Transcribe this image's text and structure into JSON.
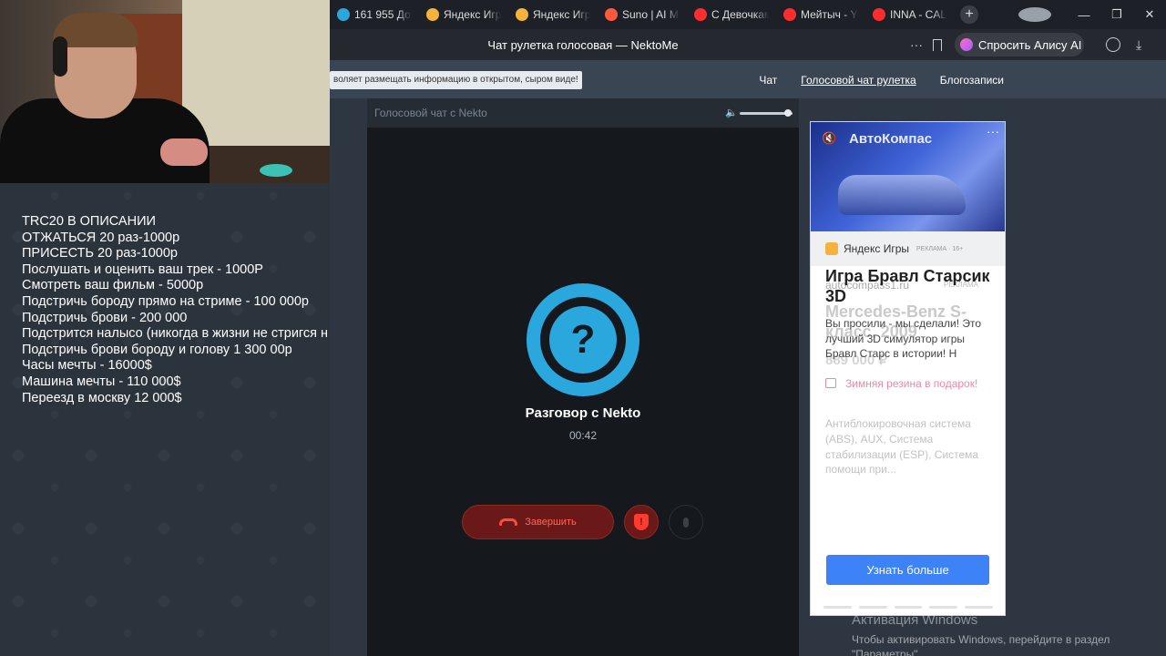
{
  "browser": {
    "tabs": [
      {
        "title": "161 955 Дол",
        "color": "#2aa7dd"
      },
      {
        "title": "Яндекс Игры",
        "color": "#f3b33d"
      },
      {
        "title": "Яндекс Игры",
        "color": "#f3b33d"
      },
      {
        "title": "Suno | AI Mu",
        "color": "#ff5a3d"
      },
      {
        "title": "С Девочкам",
        "color": "#ff2d2d"
      },
      {
        "title": "Мейтыч - Yo",
        "color": "#ff2d2d"
      },
      {
        "title": "INNA - CALI",
        "color": "#ff2d2d"
      }
    ],
    "new_tab": "+",
    "window_controls": {
      "minimize": "—",
      "maximize": "❐",
      "close": "✕"
    },
    "page_title": "Чат рулетка голосовая — NektoMe",
    "more": "···",
    "alice_button": "Спросить Алису AI",
    "download": "⤓"
  },
  "site": {
    "notice": "воляет размещать информацию в открытом, сыром виде!",
    "nav": [
      "Чат",
      "Голосовой чат рулетка",
      "Блогозаписи"
    ],
    "nav_active_index": 1
  },
  "chat": {
    "bar_title": "Голосовой чат с Nekto",
    "volume_icon": "🔈",
    "volume_level": 0.92,
    "avatar_symbol": "?",
    "call_title": "Разговор с Nekto",
    "timer": "00:42",
    "end_button": "Завершить",
    "report_icon": "!"
  },
  "ad": {
    "mute_icon": "🔇",
    "menu_icon": "···",
    "logo_text": "АвтоКомпас",
    "brand": "Яндекс Игры",
    "brand_tag": "РЕКЛАМА · 16+",
    "ghost_site": "autocompass1.ru",
    "ghost_site_tag": "РЕКЛАМА",
    "title": "Игра Бравл Старсик 3D",
    "ghost_title": "Mercedes-Benz S-класс, 2009",
    "text": "Вы просили - мы сделали! Это лучший 3D симулятор игры Бравл Старс в истории! Н",
    "ghost_price": "889 000 ₽",
    "gift": "Зимняя резина в подарок!",
    "desc": "Антиблокировочная система (ABS), AUX, Система стабилизации (ESP), Система помощи при...",
    "cta": "Узнать больше"
  },
  "windows_activation": {
    "title": "Активация Windows",
    "text": "Чтобы активировать Windows, перейдите в раздел \"Параметры\"."
  },
  "stream_overlay": {
    "lines": [
      "TRC20 В ОПИСАНИИ",
      "ОТЖАТЬСЯ 20 раз-1000р",
      "ПРИСЕСТЬ 20 раз-1000р",
      "Послушать и оценить ваш трек - 1000Р",
      "Смотреть ваш фильм - 5000р",
      "Подстричь бороду прямо на стриме - 100 000р",
      "Подстричь брови - 200 000",
      "Подстрится налысо (никогда в жизни не стригся н",
      "Подстричь брови бороду и голову 1 300 00р",
      "Часы мечты - 16000$",
      "Машина мечты - 110 000$",
      "Переезд в москву 12 000$"
    ]
  }
}
